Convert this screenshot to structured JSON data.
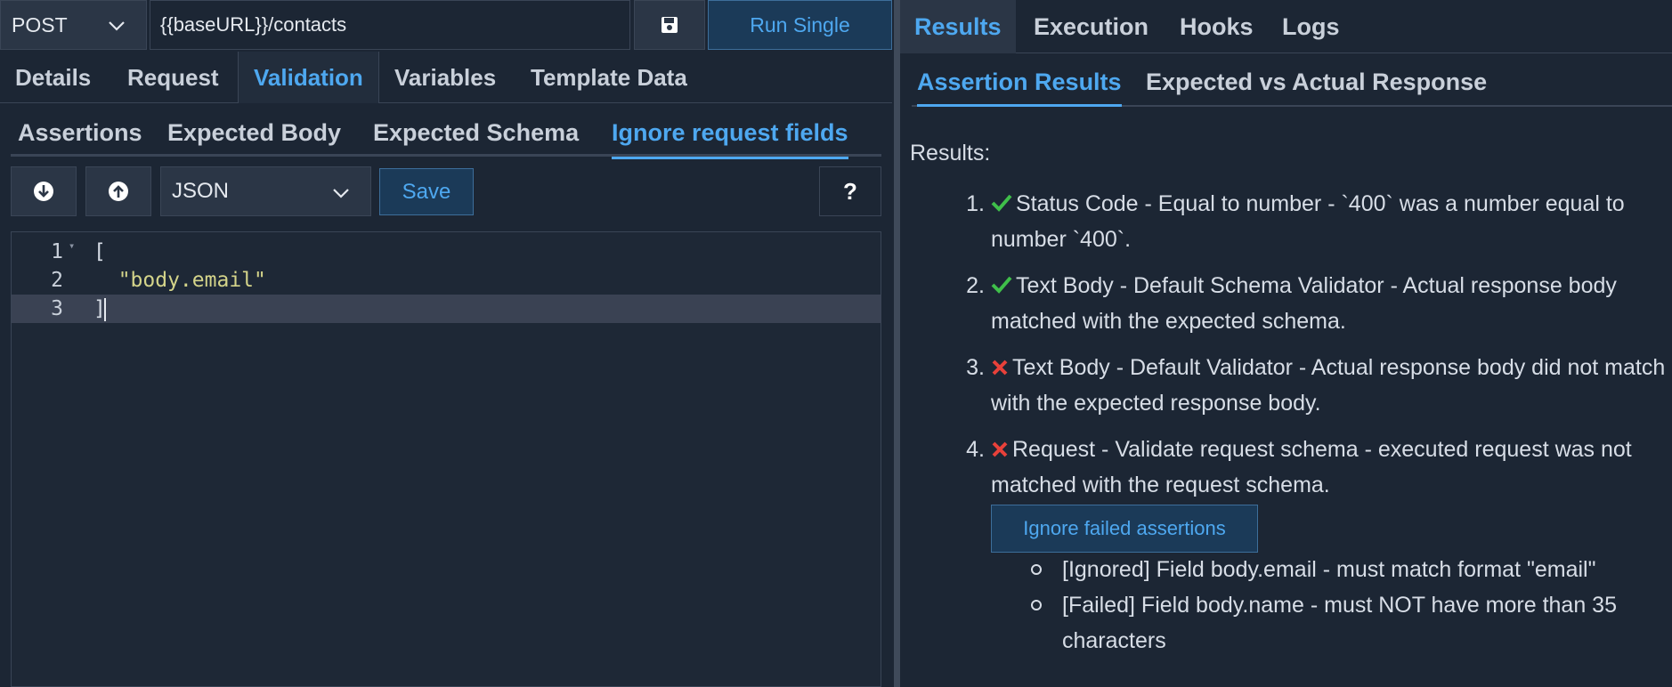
{
  "request": {
    "method": "POST",
    "url": "{{baseURL}}/contacts",
    "run_label": "Run Single"
  },
  "main_tabs": [
    "Details",
    "Request",
    "Validation",
    "Variables",
    "Template Data"
  ],
  "main_tab_active": "Validation",
  "validation_tabs": [
    "Assertions",
    "Expected Body",
    "Expected Schema",
    "Ignore request fields"
  ],
  "validation_tab_active": "Ignore request fields",
  "editor_toolbar": {
    "format": "JSON",
    "save_label": "Save",
    "help_label": "?"
  },
  "editor": {
    "lines": [
      {
        "num": "1",
        "text": "["
      },
      {
        "num": "2",
        "text": "  \"body.email\""
      },
      {
        "num": "3",
        "text": "]"
      }
    ]
  },
  "result_tabs": [
    "Results",
    "Execution",
    "Hooks",
    "Logs"
  ],
  "result_tab_active": "Results",
  "result_subtabs": [
    "Assertion Results",
    "Expected vs Actual Response"
  ],
  "result_subtab_active": "Assertion Results",
  "results": {
    "heading": "Results:",
    "items": [
      {
        "num": "1.",
        "status": "pass",
        "text": "Status Code - Equal to number - `400` was a number equal to number `400`."
      },
      {
        "num": "2.",
        "status": "pass",
        "text": "Text Body - Default Schema Validator - Actual response body matched with the expected schema."
      },
      {
        "num": "3.",
        "status": "fail",
        "text": "Text Body - Default Validator - Actual response body did not match with the expected response body."
      },
      {
        "num": "4.",
        "status": "fail",
        "text": "Request - Validate request schema - executed request was not matched with the request schema."
      }
    ],
    "ignore_button_label": "Ignore failed assertions",
    "details": [
      "[Ignored] Field body.email - must match format \"email\"",
      "[Failed] Field body.name - must NOT have more than 35 characters"
    ]
  },
  "colors": {
    "accent": "#4ea8f0",
    "pass": "#3fbf4a",
    "fail": "#e8413a",
    "background": "#1c2634"
  }
}
